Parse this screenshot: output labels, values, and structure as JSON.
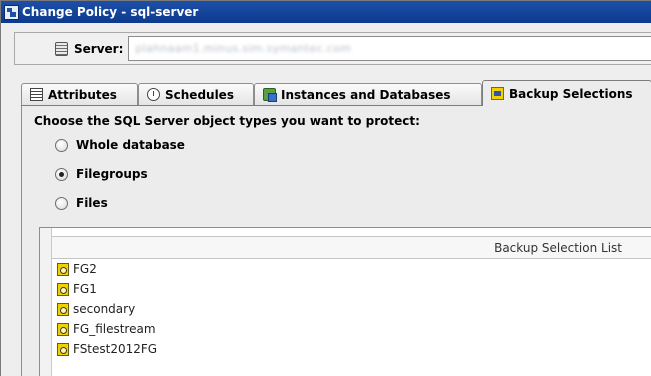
{
  "window": {
    "title": "Change Policy - sql-server"
  },
  "server": {
    "label": "Server:",
    "value": "plahnaam1.minus.sim.symantec.com"
  },
  "tabs": [
    {
      "label": "Attributes",
      "icon": "attributes-icon"
    },
    {
      "label": "Schedules",
      "icon": "clock-icon"
    },
    {
      "label": "Instances and Databases",
      "icon": "instances-icon"
    },
    {
      "label": "Backup Selections",
      "icon": "backup-selections-icon",
      "active": true
    }
  ],
  "backup": {
    "prompt": "Choose the SQL Server object types you want to protect:",
    "options": [
      {
        "label": "Whole database",
        "checked": false
      },
      {
        "label": "Filegroups",
        "checked": true
      },
      {
        "label": "Files",
        "checked": false
      }
    ],
    "list_header": "Backup Selection List",
    "items": [
      "FG2",
      "FG1",
      "secondary",
      "FG_filestream",
      "FStest2012FG"
    ]
  }
}
